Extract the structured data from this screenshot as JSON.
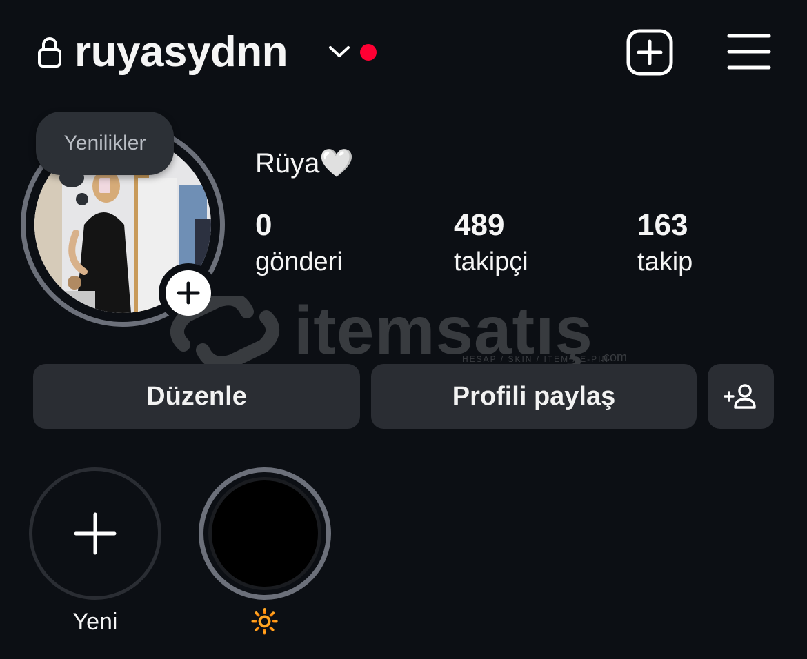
{
  "header": {
    "username": "ruyasydnn",
    "lock_icon": "lock-icon",
    "chevron_icon": "chevron-down-icon",
    "notification_dot_color": "#ff0033",
    "create_icon": "plus-square-icon",
    "menu_icon": "hamburger-menu-icon"
  },
  "profile": {
    "tooltip": "Yenilikler",
    "display_name": "Rüya🤍",
    "add_story_icon": "plus-icon",
    "stats": [
      {
        "value": "0",
        "label": "gönderi"
      },
      {
        "value": "489",
        "label": "takipçi"
      },
      {
        "value": "163",
        "label": "takip"
      }
    ]
  },
  "watermark": {
    "text": "itemsatış",
    "subtext": "HESAP / SKIN / ITEM / E-PIN",
    "suffix": ".com"
  },
  "actions": {
    "edit_label": "Düzenle",
    "share_label": "Profili paylaş",
    "add_user_icon": "add-person-icon"
  },
  "highlights": [
    {
      "label": "Yeni",
      "icon": "plus-icon"
    },
    {
      "label": "🔆",
      "icon": "none"
    }
  ],
  "colors": {
    "background": "#0c0f14",
    "button_bg": "#2a2d33",
    "ring": "#6c707a",
    "text": "#f5f5f5"
  }
}
